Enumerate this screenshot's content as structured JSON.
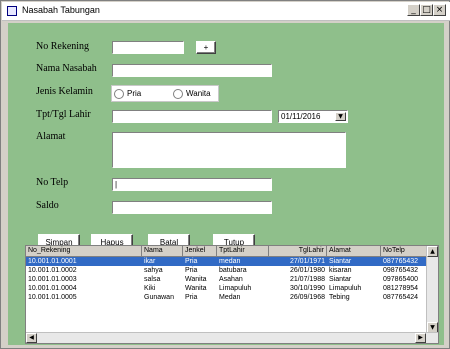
{
  "window": {
    "title": "Nasabah Tabungan"
  },
  "titlebar_buttons": {
    "minimize": "_",
    "maximize": "□",
    "close": "×"
  },
  "form": {
    "no_rekening_label": "No Rekening",
    "no_rekening_value": "",
    "add_button": "+",
    "nama_label": "Nama Nasabah",
    "nama_value": "",
    "jenis_kelamin_label": "Jenis Kelamin",
    "gender_options": [
      "Pria",
      "Wanita"
    ],
    "tpt_tgl_label": "Tpt/Tgl Lahir",
    "tempat_value": "",
    "tanggal_value": "01/11/2016",
    "alamat_label": "Alamat",
    "alamat_value": "",
    "telp_label": "No Telp",
    "telp_value": "|",
    "saldo_label": "Saldo",
    "saldo_value": ""
  },
  "actions": {
    "simpan": "Simpan",
    "hapus": "Hapus",
    "batal": "Batal",
    "tutup": "Tutup"
  },
  "grid": {
    "columns": [
      "No_Rekening",
      "Nama",
      "Jenkel",
      "TptLahir",
      "TglLahir",
      "Alamat",
      "NoTelp"
    ],
    "rows": [
      [
        "10.001.01.0001",
        "ikar",
        "Pria",
        "medan",
        "27/01/1971",
        "Siantar",
        "087765432"
      ],
      [
        "10.001.01.0002",
        "sahya",
        "Pria",
        "batubara",
        "26/01/1980",
        "kisaran",
        "098765432"
      ],
      [
        "10.001.01.0003",
        "salsa",
        "Wanita",
        "Asahan",
        "21/07/1988",
        "Siantar",
        "097865400"
      ],
      [
        "10.001.01.0004",
        "Kiki",
        "Wanita",
        "Limapuluh",
        "30/10/1990",
        "Limapuluh",
        "081278954"
      ],
      [
        "10.001.01.0005",
        "Gunawan",
        "Pria",
        "Medan",
        "26/09/1968",
        "Tebing",
        "087765424"
      ]
    ],
    "selected_row": 0
  }
}
